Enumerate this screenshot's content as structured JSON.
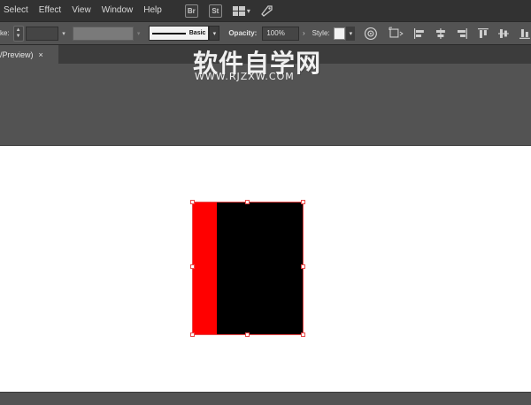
{
  "menubar": {
    "items": [
      "Select",
      "Effect",
      "View",
      "Window",
      "Help"
    ],
    "app_badges": [
      "Br",
      "St"
    ]
  },
  "controlbar": {
    "stroke_label": "ke:",
    "brush_label": "Basic",
    "opacity_label": "Opacity:",
    "opacity_value": "100%",
    "style_label": "Style:"
  },
  "tabbar": {
    "doc_tab_label": "/Preview)",
    "close_glyph": "×"
  },
  "watermark": {
    "title": "软件自学网",
    "subtitle": "WWW.RJZXW.COM"
  },
  "artwork": {
    "red_fill": "#ff0000",
    "black_fill": "#000000",
    "selection_color": "#e84a4a"
  }
}
